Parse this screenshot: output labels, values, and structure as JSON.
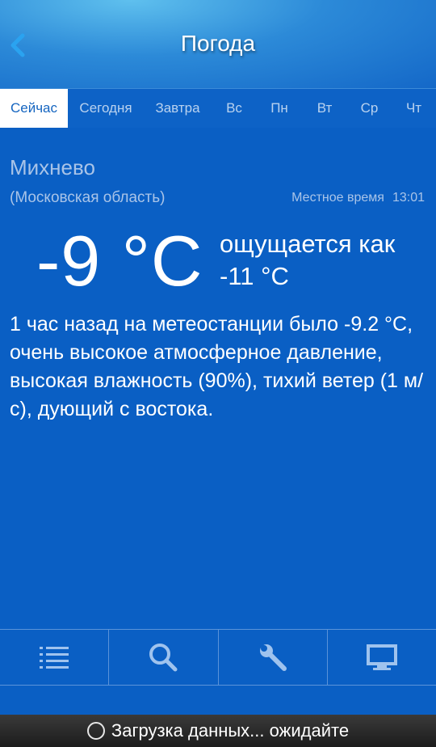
{
  "header": {
    "title": "Погода",
    "back_icon": "chevron-left-icon"
  },
  "tabs": [
    {
      "label": "Сейчас",
      "active": true
    },
    {
      "label": "Сегодня",
      "active": false
    },
    {
      "label": "Завтра",
      "active": false
    },
    {
      "label": "Вс",
      "active": false
    },
    {
      "label": "Пн",
      "active": false
    },
    {
      "label": "Вт",
      "active": false
    },
    {
      "label": "Ср",
      "active": false
    },
    {
      "label": "Чт",
      "active": false
    }
  ],
  "weather": {
    "city": "Михнево",
    "region": "(Московская область)",
    "local_time_label": "Местное время",
    "local_time": "13:01",
    "temperature": "-9 °C",
    "feels_label": "ощущается как",
    "feels_value": "-11 °C",
    "description": "1 час назад на метеостанции было -9.2 °C, очень высокое атмосферное давление, высокая влажность (90%), тихий ветер (1 м/с), дующий с востока."
  },
  "toolbar": {
    "items": [
      {
        "icon": "list-icon"
      },
      {
        "icon": "search-icon"
      },
      {
        "icon": "wrench-icon"
      },
      {
        "icon": "monitor-icon"
      }
    ]
  },
  "status": {
    "text": "Загрузка данных... ожидайте"
  },
  "colors": {
    "background": "#0a5fc4",
    "tab_active_bg": "#ffffff",
    "tab_active_text": "#1565c0",
    "accent_back": "#2aa3f0"
  }
}
